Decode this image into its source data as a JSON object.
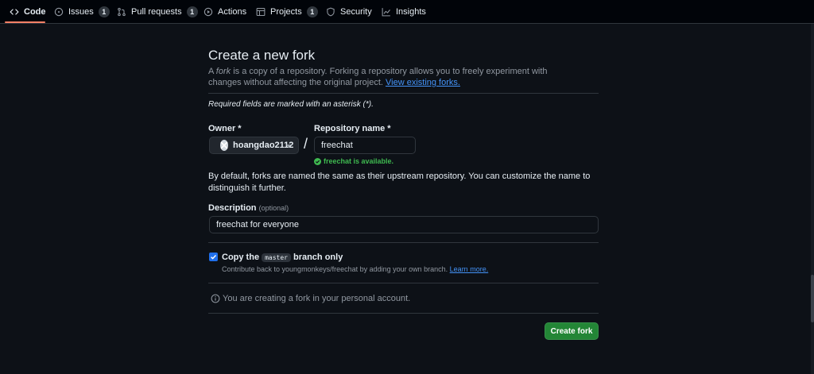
{
  "nav": {
    "tabs": [
      {
        "label": "Code",
        "icon": "code-icon"
      },
      {
        "label": "Issues",
        "icon": "issue-opened-icon",
        "count": "1"
      },
      {
        "label": "Pull requests",
        "icon": "git-pull-request-icon",
        "count": "1"
      },
      {
        "label": "Actions",
        "icon": "play-icon"
      },
      {
        "label": "Projects",
        "icon": "table-icon",
        "count": "1"
      },
      {
        "label": "Security",
        "icon": "shield-icon"
      },
      {
        "label": "Insights",
        "icon": "graph-icon"
      }
    ],
    "active_tab": "Code"
  },
  "page": {
    "title": "Create a new fork",
    "desc_prefix": "A ",
    "desc_fork": "fork",
    "desc_middle": " is a copy of a repository. Forking a repository allows you to freely experiment with changes without affecting the original project. ",
    "desc_link": "View existing forks.",
    "required_note": "Required fields are marked with an asterisk (*)."
  },
  "form": {
    "owner_label": "Owner *",
    "owner_value": "hoangdao2112",
    "repo_label": "Repository name *",
    "repo_value": "freechat",
    "slash": "/",
    "availability": "freechat is available.",
    "naming_note": "By default, forks are named the same as their upstream repository. You can customize the name to distinguish it further.",
    "description_label": "Description",
    "description_optional": "(optional)",
    "description_value": "freechat for everyone",
    "copy_prefix": "Copy the",
    "copy_branch": "master",
    "copy_suffix": "branch only",
    "copy_checked": true,
    "copy_sub": "Contribute back to youngmonkeys/freechat by adding your own branch. ",
    "copy_learn": "Learn more.",
    "info_text": "You are creating a fork in your personal account.",
    "create_button": "Create fork"
  },
  "colors": {
    "background": "#0d1117",
    "accent_green": "#238636",
    "success_text": "#3fb950",
    "link": "#4493f8",
    "checkbox": "#1f6feb",
    "tab_underline": "#f78166"
  }
}
